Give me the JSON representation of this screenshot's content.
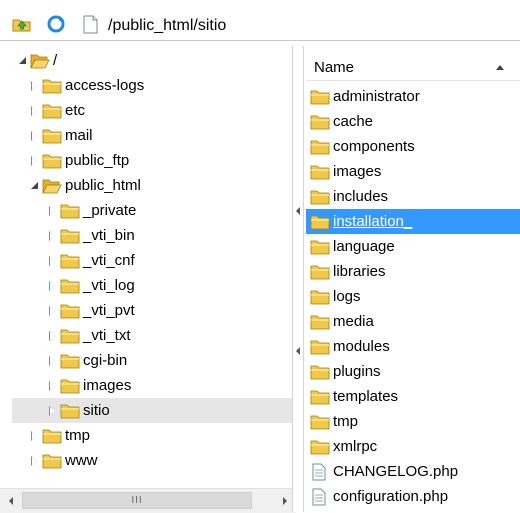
{
  "toolbar": {
    "path": "/public_html/sitio",
    "icons": [
      "up-folder-icon",
      "refresh-icon",
      "file-icon"
    ]
  },
  "tree": {
    "root_label": "/",
    "items": [
      {
        "label": "access-logs",
        "state": "collapsed"
      },
      {
        "label": "etc",
        "state": "collapsed"
      },
      {
        "label": "mail",
        "state": "collapsed"
      },
      {
        "label": "public_ftp",
        "state": "collapsed"
      },
      {
        "label": "public_html",
        "state": "expanded"
      },
      {
        "label": "_private",
        "state": "collapsed"
      },
      {
        "label": "_vti_bin",
        "state": "collapsed"
      },
      {
        "label": "_vti_cnf",
        "state": "collapsed"
      },
      {
        "label": "_vti_log",
        "state": "collapsed-hover"
      },
      {
        "label": "_vti_pvt",
        "state": "collapsed"
      },
      {
        "label": "_vti_txt",
        "state": "collapsed"
      },
      {
        "label": "cgi-bin",
        "state": "collapsed"
      },
      {
        "label": "images",
        "state": "collapsed"
      },
      {
        "label": "sitio",
        "state": "selected"
      },
      {
        "label": "tmp",
        "state": "collapsed"
      },
      {
        "label": "www",
        "state": "collapsed"
      }
    ],
    "scrollbar_grip": "III"
  },
  "list": {
    "column_name": "Name",
    "items": [
      {
        "label": "administrator",
        "type": "folder"
      },
      {
        "label": "cache",
        "type": "folder"
      },
      {
        "label": "components",
        "type": "folder"
      },
      {
        "label": "images",
        "type": "folder"
      },
      {
        "label": "includes",
        "type": "folder"
      },
      {
        "label": "installation_",
        "type": "folder",
        "highlight": true
      },
      {
        "label": "language",
        "type": "folder"
      },
      {
        "label": "libraries",
        "type": "folder"
      },
      {
        "label": "logs",
        "type": "folder"
      },
      {
        "label": "media",
        "type": "folder"
      },
      {
        "label": "modules",
        "type": "folder"
      },
      {
        "label": "plugins",
        "type": "folder"
      },
      {
        "label": "templates",
        "type": "folder"
      },
      {
        "label": "tmp",
        "type": "folder"
      },
      {
        "label": "xmlrpc",
        "type": "folder"
      },
      {
        "label": "CHANGELOG.php",
        "type": "file"
      },
      {
        "label": "configuration.php",
        "type": "file"
      }
    ]
  },
  "colors": {
    "selection": "#3399ff",
    "tree_selected": "#e6e6e6",
    "folder": "#f0c94a"
  }
}
